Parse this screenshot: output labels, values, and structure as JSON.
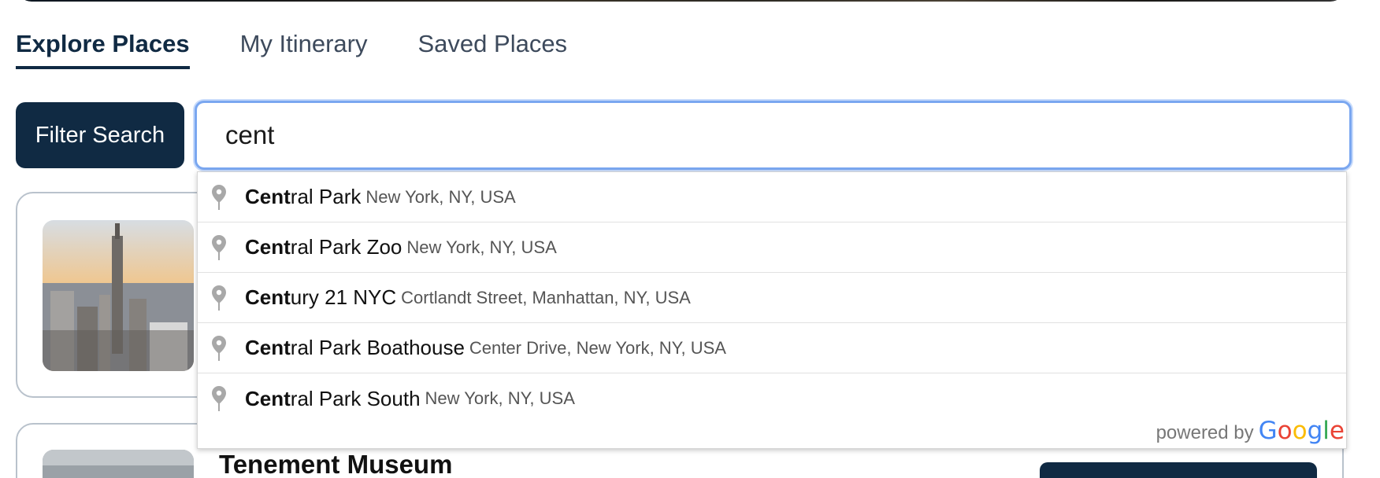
{
  "tabs": [
    {
      "label": "Explore Places",
      "active": true
    },
    {
      "label": "My Itinerary",
      "active": false
    },
    {
      "label": "Saved Places",
      "active": false
    }
  ],
  "filter_button": {
    "label": "Filter Search"
  },
  "search": {
    "value": "cent"
  },
  "suggestions": [
    {
      "match": "Cent",
      "rest": "ral Park",
      "secondary": "New York, NY, USA"
    },
    {
      "match": "Cent",
      "rest": "ral Park Zoo",
      "secondary": "New York, NY, USA"
    },
    {
      "match": "Cent",
      "rest": "ury 21 NYC",
      "secondary": "Cortlandt Street, Manhattan, NY, USA"
    },
    {
      "match": "Cent",
      "rest": "ral Park Boathouse",
      "secondary": "Center Drive, New York, NY, USA"
    },
    {
      "match": "Cent",
      "rest": "ral Park South",
      "secondary": "New York, NY, USA"
    }
  ],
  "powered_by": {
    "label": "powered by",
    "logo_letters": [
      "G",
      "o",
      "o",
      "g",
      "l",
      "e"
    ],
    "logo_colors": [
      "#4285F4",
      "#EA4335",
      "#FBBC05",
      "#4285F4",
      "#34A853",
      "#EA4335"
    ]
  },
  "cards": [
    {
      "title": "Tenement Museum"
    }
  ],
  "colors": {
    "primary": "#102a43",
    "focus_ring": "#7aa7f0"
  }
}
